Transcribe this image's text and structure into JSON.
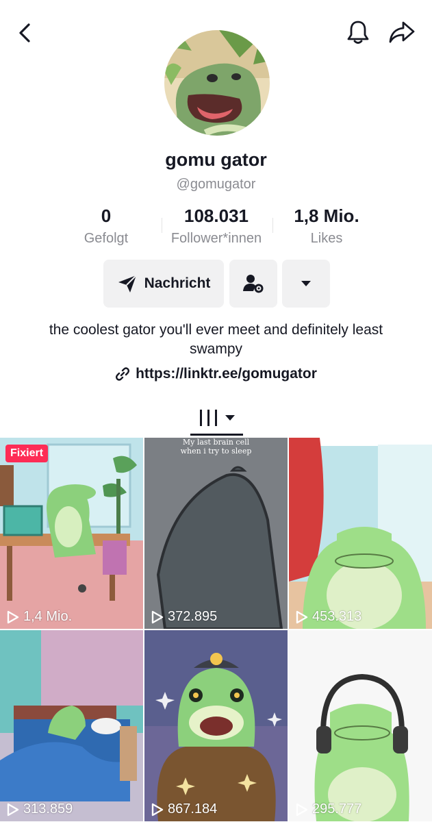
{
  "header": {
    "back_icon": "chevron-left-icon",
    "bell_icon": "bell-icon",
    "share_icon": "share-arrow-icon"
  },
  "profile": {
    "name": "gomu gator",
    "handle": "@gomugator",
    "bio": "the coolest gator you'll ever meet and definitely least swampy",
    "link": "https://linktr.ee/gomugator"
  },
  "stats": [
    {
      "value": "0",
      "label": "Gefolgt"
    },
    {
      "value": "108.031",
      "label": "Follower*innen"
    },
    {
      "value": "1,8 Mio.",
      "label": "Likes"
    }
  ],
  "actions": {
    "message_label": "Nachricht"
  },
  "videos": [
    {
      "views": "1,4 Mio.",
      "badge": "Fixiert"
    },
    {
      "views": "372.895",
      "caption": "My last brain cell when i try to sleep"
    },
    {
      "views": "453.313"
    },
    {
      "views": "313.859"
    },
    {
      "views": "867.184"
    },
    {
      "views": "295.777"
    }
  ],
  "colors": {
    "accent": "#fe2c55",
    "text": "#161823",
    "muted": "#8a8b91",
    "button_bg": "#f1f1f2"
  }
}
